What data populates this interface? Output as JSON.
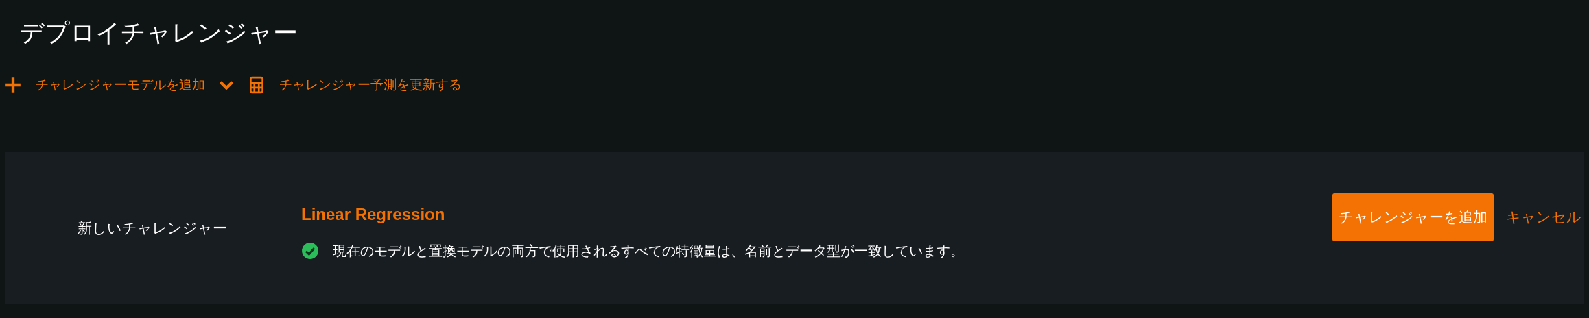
{
  "page": {
    "title": "デプロイチャレンジャー"
  },
  "toolbar": [
    {
      "kind": "add",
      "label": "チャレンジャーモデルを追加",
      "has_dropdown": true
    },
    {
      "kind": "calculator",
      "label": "チャレンジャー予測を更新する",
      "has_dropdown": false
    }
  ],
  "panel": {
    "label": "新しいチャレンジャー",
    "model_name": "Linear Regression",
    "compatible": true,
    "message": "現在のモデルと置換モデルの両方で使用されるすべての特徴量は、名前とデータ型が一致しています。",
    "primary_button": "チャレンジャーを追加",
    "cancel_link": "キャンセル"
  }
}
